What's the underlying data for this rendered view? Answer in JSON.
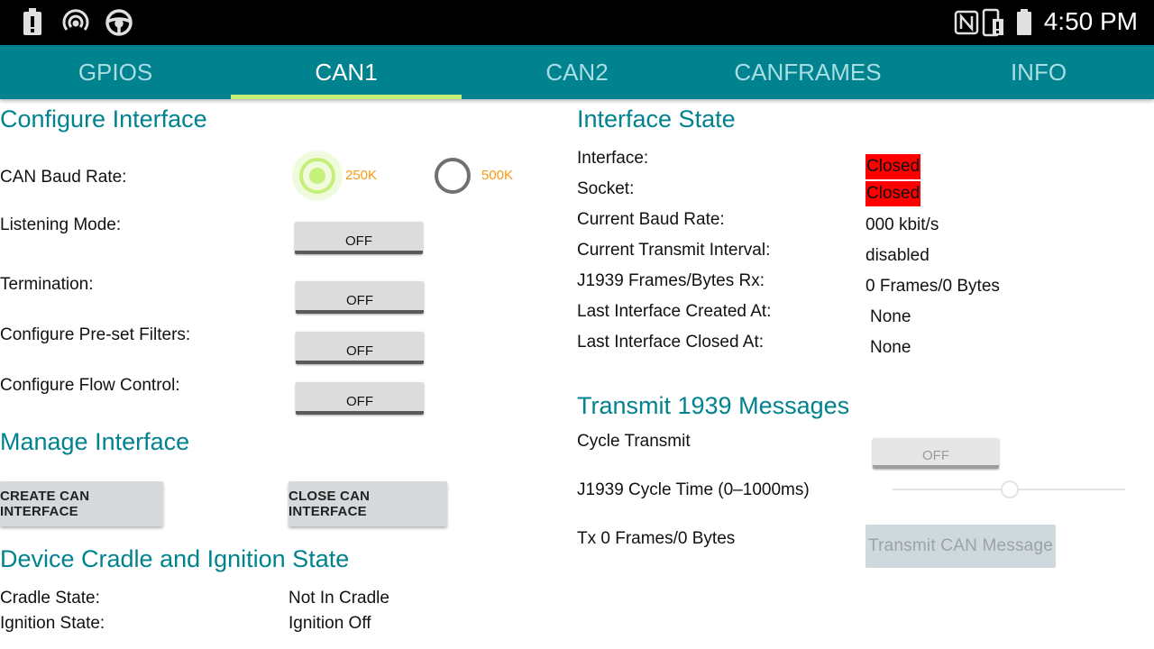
{
  "status_bar": {
    "time": "4:50 PM",
    "icons": [
      "alert-icon",
      "nfc-icon",
      "steering-wheel-icon",
      "nfc-n-icon",
      "phone-alert-icon",
      "battery-icon"
    ]
  },
  "tabs": [
    {
      "label": "GPIOS",
      "active": false
    },
    {
      "label": "CAN1",
      "active": true
    },
    {
      "label": "CAN2",
      "active": false
    },
    {
      "label": "CANFRAMES",
      "active": false
    },
    {
      "label": "INFO",
      "active": false
    }
  ],
  "configure": {
    "heading": "Configure Interface",
    "baud_label": "CAN Baud Rate:",
    "baud_options": [
      {
        "label": "250K",
        "selected": true
      },
      {
        "label": "500K",
        "selected": false
      }
    ],
    "listening_label": "Listening Mode:",
    "listening_value": "OFF",
    "termination_label": "Termination:",
    "termination_value": "OFF",
    "filters_label": "Configure Pre-set Filters:",
    "filters_value": "OFF",
    "flow_label": "Configure Flow Control:",
    "flow_value": "OFF"
  },
  "manage": {
    "heading": "Manage Interface",
    "create_label": "CREATE CAN INTERFACE",
    "close_label": "CLOSE CAN INTERFACE"
  },
  "cradle": {
    "heading": "Device Cradle and Ignition State",
    "cradle_label": "Cradle State:",
    "cradle_value": "Not In Cradle",
    "ignition_label": "Ignition State:",
    "ignition_value": "Ignition Off"
  },
  "interface_state": {
    "heading": "Interface State",
    "interface_label": "Interface:",
    "interface_value": "Closed",
    "socket_label": "Socket:",
    "socket_value": "Closed",
    "baud_label": "Current Baud Rate:",
    "baud_value": "000 kbit/s",
    "interval_label": "Current Transmit Interval:",
    "interval_value": "disabled",
    "rx_label": "J1939 Frames/Bytes Rx:",
    "rx_value": "0 Frames/0 Bytes",
    "created_label": "Last Interface Created At:",
    "created_value": "None",
    "closed_label": "Last Interface Closed At:",
    "closed_value": "None",
    "status_color": "#ff0000"
  },
  "transmit": {
    "heading": "Transmit 1939 Messages",
    "cycle_label": "Cycle Transmit",
    "cycle_value": "OFF",
    "cycle_time_label": "J1939 Cycle Time (0–1000ms)",
    "cycle_time_level": 0.5,
    "tx_label": "Tx 0 Frames/0 Bytes",
    "transmit_button": "Transmit CAN Message"
  },
  "colors": {
    "accent": "#00838f",
    "tab_indicator": "#c5f07a",
    "radio_label": "#f39c12"
  }
}
